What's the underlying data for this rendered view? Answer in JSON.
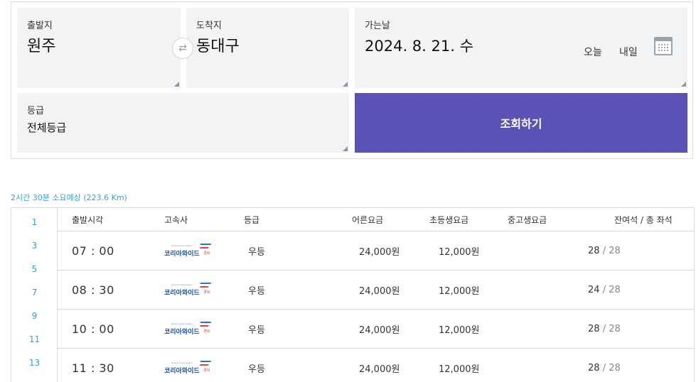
{
  "search": {
    "departure": {
      "label": "출발지",
      "value": "원주"
    },
    "arrival": {
      "label": "도착지",
      "value": "동대구"
    },
    "date": {
      "label": "가는날",
      "value": "2024. 8. 21. 수",
      "today": "오늘",
      "tomorrow": "내일"
    },
    "grade": {
      "label": "등급",
      "value": "전체등급"
    },
    "submit_label": "조회하기"
  },
  "duration_text": "2시간 30분 소요예상 (223.6 Km)",
  "scroll_numbers": [
    "1",
    "3",
    "5",
    "7",
    "9",
    "11",
    "13"
  ],
  "table": {
    "headers": {
      "time": "출발시각",
      "company": "고속사",
      "grade": "등급",
      "adult": "어른요금",
      "child": "초등생요금",
      "teen": "중고생요금",
      "seats": "잔여석 / 총 좌석"
    },
    "company_logo": {
      "main": "코리아와이드",
      "suffix": "경북",
      "small": "where travel begins"
    },
    "rows": [
      {
        "time": "07 : 00",
        "grade": "우등",
        "adult": "24,000원",
        "child": "12,000원",
        "teen": "",
        "seats_available": "28",
        "seats_sep": "/",
        "seats_total": "28"
      },
      {
        "time": "08 : 30",
        "grade": "우등",
        "adult": "24,000원",
        "child": "12,000원",
        "teen": "",
        "seats_available": "24",
        "seats_sep": "/",
        "seats_total": "28"
      },
      {
        "time": "10 : 00",
        "grade": "우등",
        "adult": "24,000원",
        "child": "12,000원",
        "teen": "",
        "seats_available": "28",
        "seats_sep": "/",
        "seats_total": "28"
      },
      {
        "time": "11 : 30",
        "grade": "우등",
        "adult": "24,000원",
        "child": "12,000원",
        "teen": "",
        "seats_available": "28",
        "seats_sep": "/",
        "seats_total": "28"
      }
    ]
  },
  "colors": {
    "accent": "#5a53b5",
    "link": "#3aa0c8",
    "box_bg": "#f2f3f5"
  }
}
